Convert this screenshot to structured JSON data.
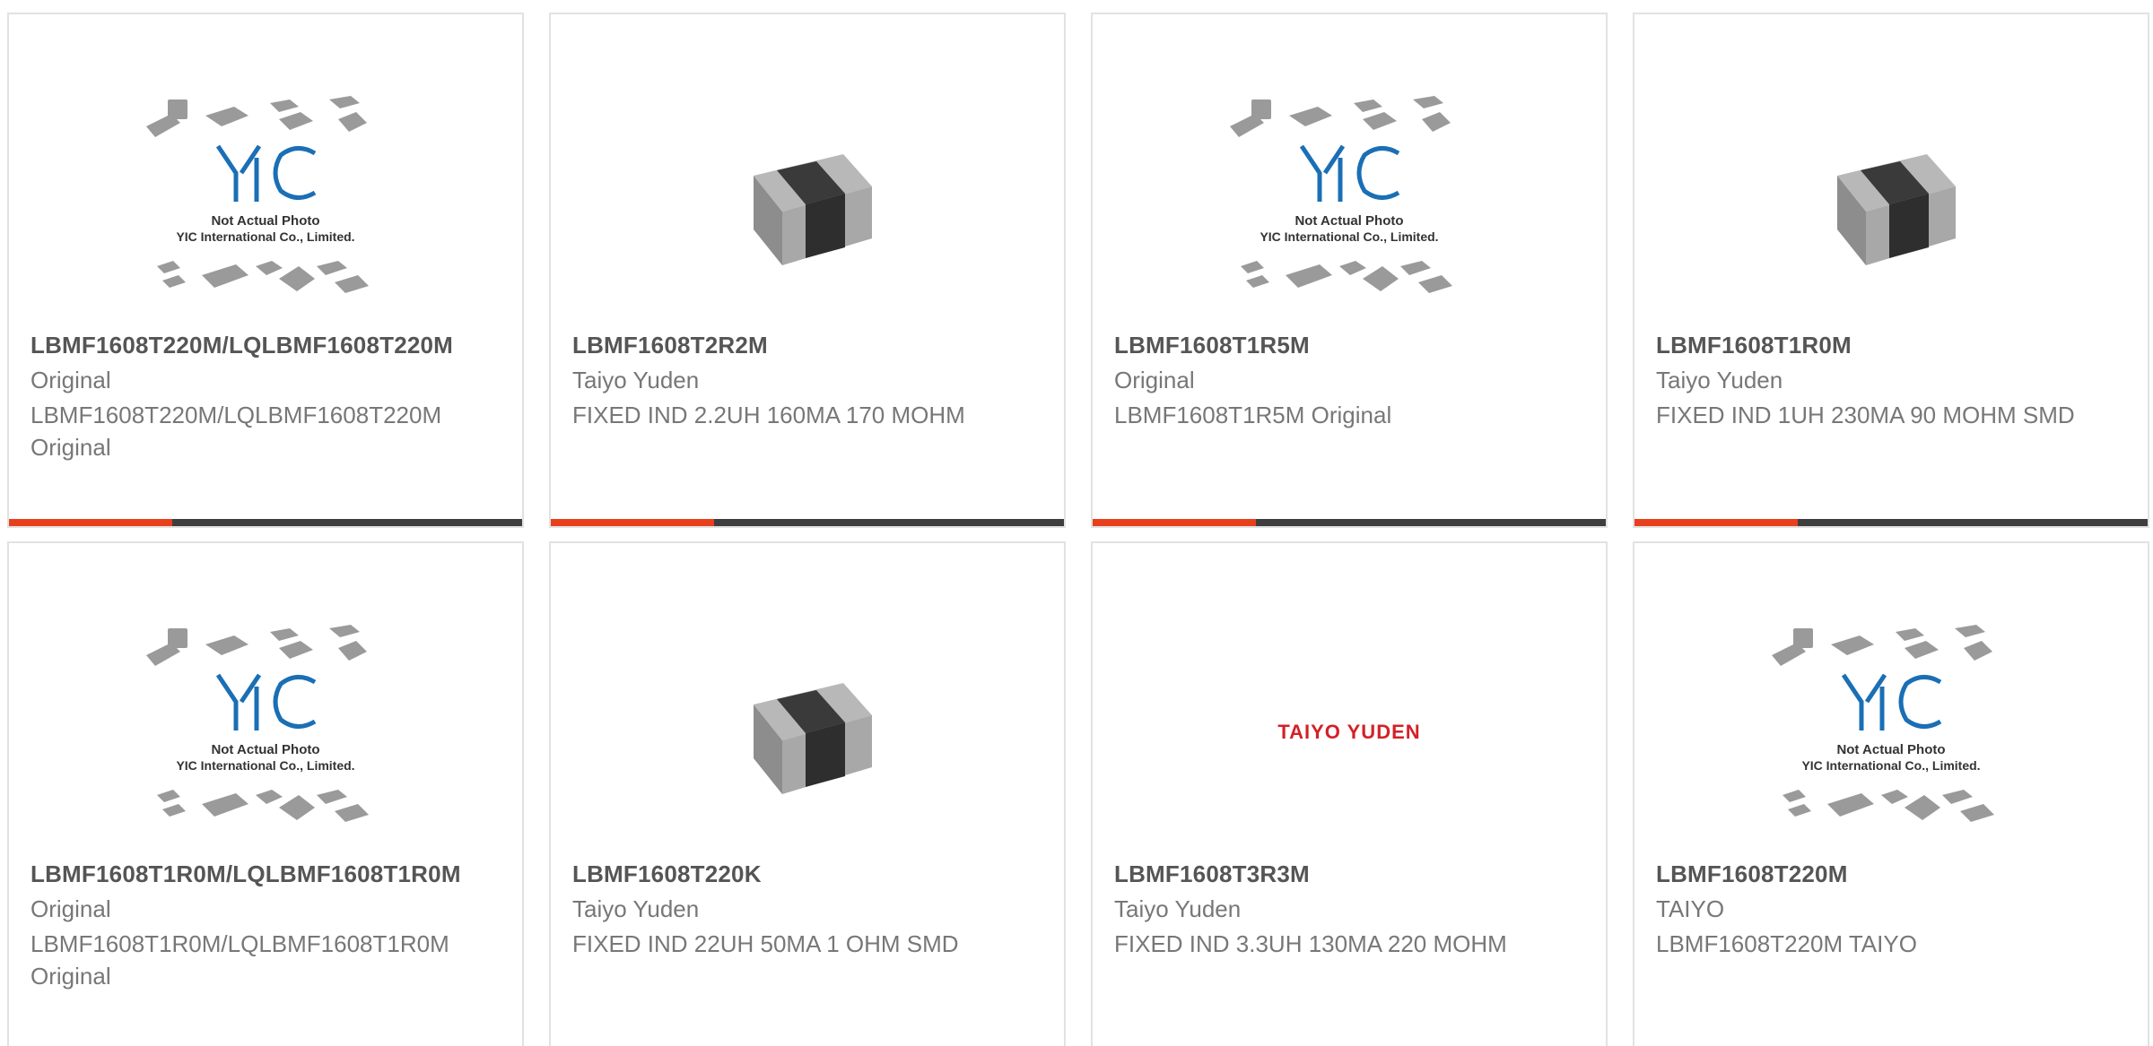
{
  "accent_color": "#e8401c",
  "bar_color": "#3e3e3e",
  "placeholder": {
    "line1": "Not Actual Photo",
    "line2": "YIC International Co., Limited."
  },
  "products": [
    {
      "part": "LBMF1608T220M/LQLBMF1608T220M",
      "maker": "Original",
      "desc": "LBMF1608T220M/LQLBMF1608T220M Original",
      "image": "placeholder"
    },
    {
      "part": "LBMF1608T2R2M",
      "maker": "Taiyo Yuden",
      "desc": "FIXED IND 2.2UH 160MA 170 MOHM",
      "image": "chip"
    },
    {
      "part": "LBMF1608T1R5M",
      "maker": "Original",
      "desc": "LBMF1608T1R5M Original",
      "image": "placeholder"
    },
    {
      "part": "LBMF1608T1R0M",
      "maker": "Taiyo Yuden",
      "desc": "FIXED IND 1UH 230MA 90 MOHM SMD",
      "image": "chip"
    },
    {
      "part": "LBMF1608T1R0M/LQLBMF1608T1R0M",
      "maker": "Original",
      "desc": "LBMF1608T1R0M/LQLBMF1608T1R0M Original",
      "image": "placeholder"
    },
    {
      "part": "LBMF1608T220K",
      "maker": "Taiyo Yuden",
      "desc": "FIXED IND 22UH 50MA 1 OHM SMD",
      "image": "chip"
    },
    {
      "part": "LBMF1608T3R3M",
      "maker": "Taiyo Yuden",
      "desc": "FIXED IND 3.3UH 130MA 220 MOHM",
      "image": "brand",
      "brand_text": "TAIYO YUDEN"
    },
    {
      "part": "LBMF1608T220M",
      "maker": "TAIYO",
      "desc": "LBMF1608T220M TAIYO",
      "image": "placeholder"
    }
  ]
}
